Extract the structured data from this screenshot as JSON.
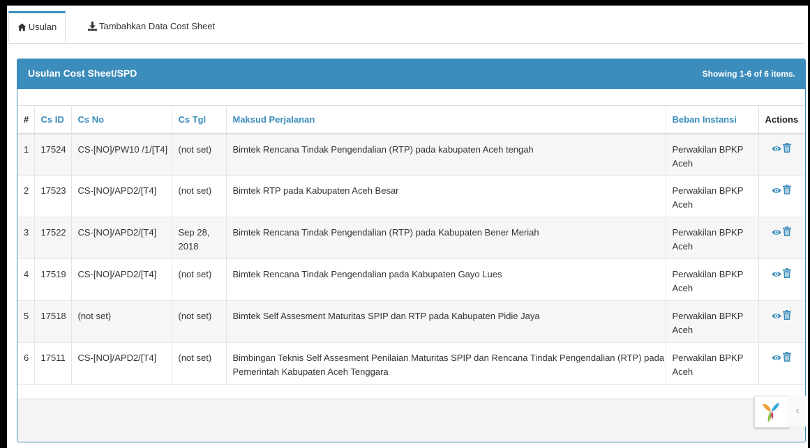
{
  "tabs": [
    {
      "label": "Usulan",
      "icon": "home-icon",
      "active": true
    },
    {
      "label": "Tambahkan Data Cost Sheet",
      "icon": "download-icon",
      "active": false
    }
  ],
  "panel": {
    "title": "Usulan Cost Sheet/SPD",
    "summary_prefix": "Showing ",
    "summary_range": "1-6",
    "summary_of": " of ",
    "summary_total": "6",
    "summary_suffix": " items."
  },
  "table": {
    "columns": [
      "#",
      "Cs ID",
      "Cs No",
      "Cs Tgl",
      "Maksud Perjalanan",
      "Beban Instansi",
      "Actions"
    ],
    "rows": [
      {
        "num": "1",
        "cs_id": "17524",
        "cs_no": "CS-[NO]/PW10 /1/[T4]",
        "cs_tgl": "(not set)",
        "maksud": "Bimtek Rencana Tindak Pengendalian (RTP) pada kabupaten Aceh tengah",
        "beban": "Perwakilan BPKP Aceh"
      },
      {
        "num": "2",
        "cs_id": "17523",
        "cs_no": "CS-[NO]/APD2/[T4]",
        "cs_tgl": "(not set)",
        "maksud": "Bimtek RTP pada Kabupaten Aceh Besar",
        "beban": "Perwakilan BPKP Aceh"
      },
      {
        "num": "3",
        "cs_id": "17522",
        "cs_no": "CS-[NO]/APD2/[T4]",
        "cs_tgl": "Sep 28, 2018",
        "maksud": "Bimtek Rencana Tindak Pengendalian (RTP) pada Kabupaten Bener Meriah",
        "beban": "Perwakilan BPKP Aceh"
      },
      {
        "num": "4",
        "cs_id": "17519",
        "cs_no": "CS-[NO]/APD2/[T4]",
        "cs_tgl": "(not set)",
        "maksud": "Bimtek Rencana Tindak Pengendalian pada Kabupaten Gayo Lues",
        "beban": "Perwakilan BPKP Aceh"
      },
      {
        "num": "5",
        "cs_id": "17518",
        "cs_no": "(not set)",
        "cs_tgl": "(not set)",
        "maksud": "Bimtek Self Assesment Maturitas SPIP dan RTP pada Kabupaten Pidie Jaya",
        "beban": "Perwakilan BPKP Aceh"
      },
      {
        "num": "6",
        "cs_id": "17511",
        "cs_no": "CS-[NO]/APD2/[T4]",
        "cs_tgl": "(not set)",
        "maksud": "Bimbingan Teknis Self Assesment Penilaian Maturitas SPIP dan Rencana Tindak Pengendalian (RTP) pada Pemerintah Kabupaten Aceh Tenggara",
        "beban": "Perwakilan BPKP Aceh"
      }
    ]
  },
  "row_actions": [
    "eye-icon",
    "trash-icon"
  ],
  "widget": {
    "icon": "yii-logo-icon",
    "collapse_icon": "chevron-left-icon",
    "collapse_glyph": "‹"
  },
  "colors": {
    "accent": "#3c8dbc",
    "stripe": "#f6f6f6"
  }
}
